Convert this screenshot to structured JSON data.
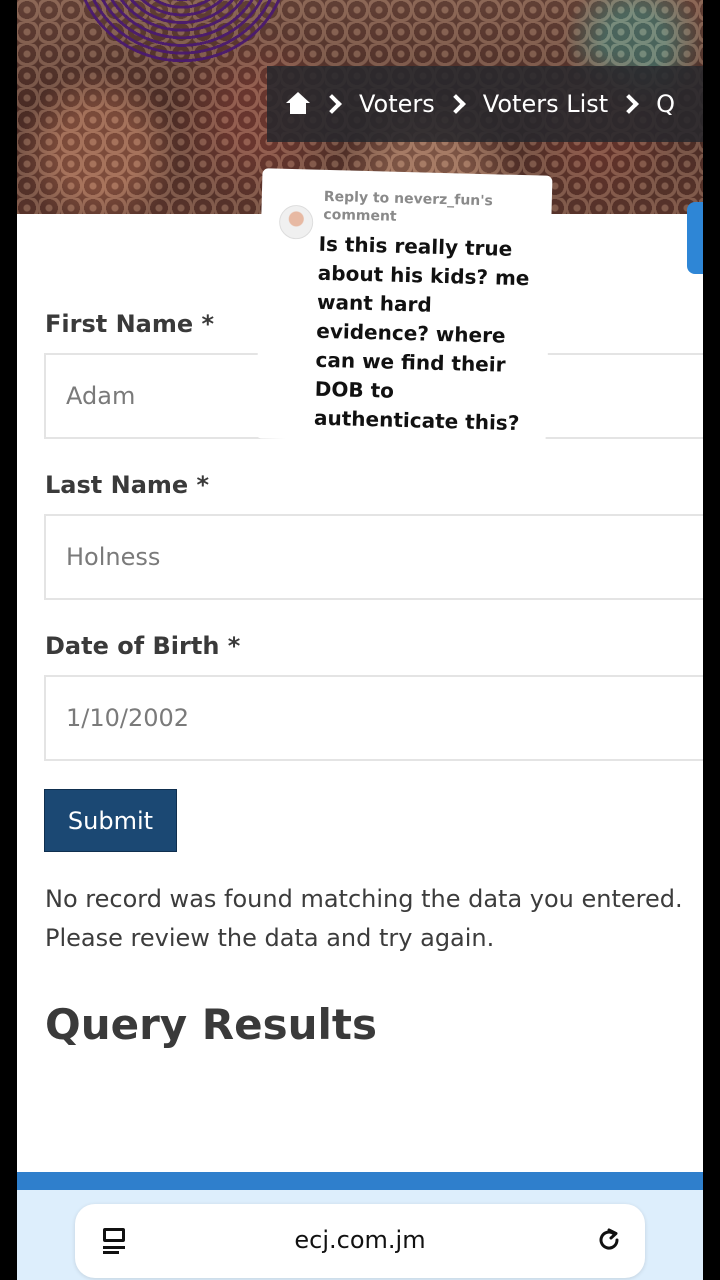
{
  "breadcrumb": {
    "items": [
      "Voters",
      "Voters List",
      "Q"
    ]
  },
  "form": {
    "first_name_label": "First Name *",
    "first_name_value": "Adam",
    "last_name_label": "Last Name *",
    "last_name_value": "Holness",
    "dob_label": "Date of Birth *",
    "dob_value": "1/10/2002",
    "submit_label": "Submit"
  },
  "message": "No record was found matching the data you entered. Please review the data and try again.",
  "results_title": "Query Results",
  "comment": {
    "reply_to": "Reply to neverz_fun's comment",
    "text": "Is this really true about his kids? me want hard evidence? where can we find their DOB to authenticate this?"
  },
  "browser": {
    "url": "ecj.com.jm"
  },
  "colors": {
    "submit_bg": "#1b4873",
    "footer_stripe": "#2f7fcc",
    "browser_bg": "#ddeefc"
  },
  "icons": [
    "home-icon",
    "chevron-right-icon",
    "reader-mode-icon",
    "reload-icon"
  ]
}
